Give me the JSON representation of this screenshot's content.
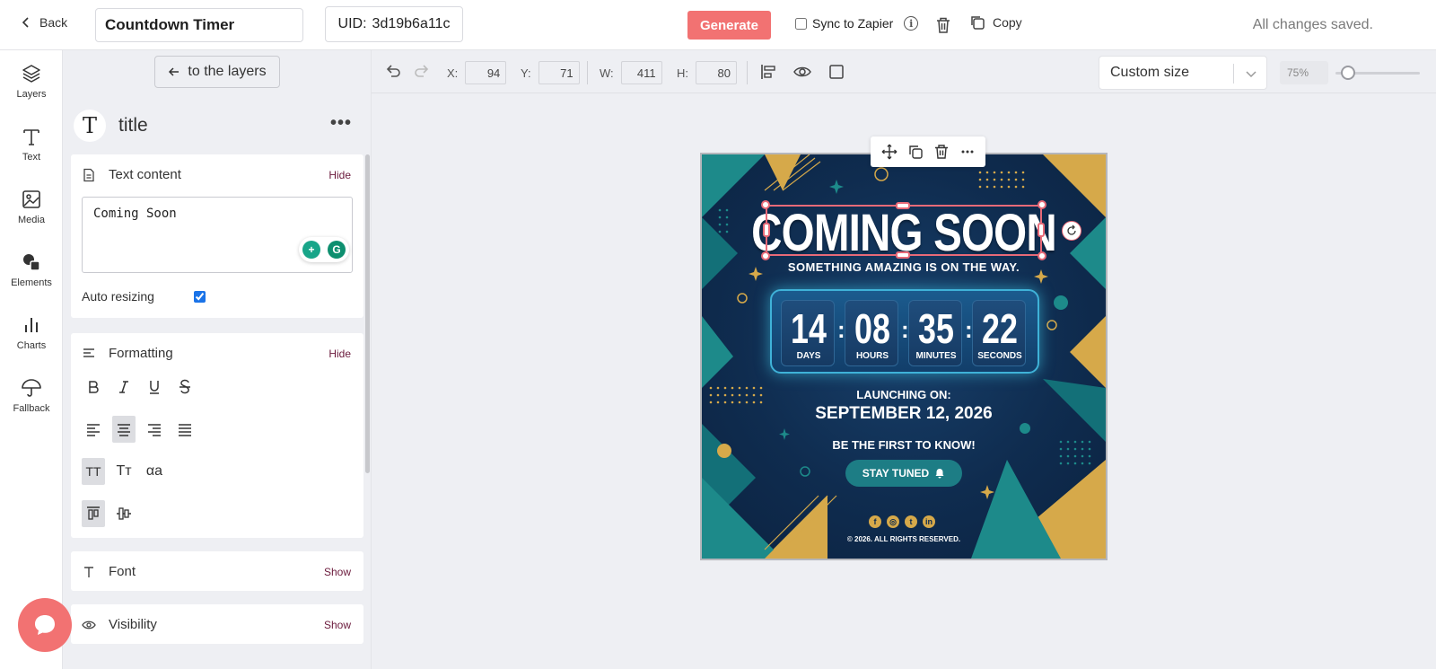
{
  "header": {
    "back_label": "Back",
    "project_name": "Countdown Timer",
    "uid_label": "UID:",
    "uid_value": "3d19b6a11c",
    "generate_label": "Generate",
    "sync_label": "Sync to Zapier",
    "copy_label": "Copy",
    "status": "All changes saved.",
    "accent_color": "#f27272"
  },
  "rail": {
    "items": [
      {
        "label": "Layers",
        "icon": "layers-icon"
      },
      {
        "label": "Text",
        "icon": "text-icon"
      },
      {
        "label": "Media",
        "icon": "image-icon"
      },
      {
        "label": "Elements",
        "icon": "shapes-icon"
      },
      {
        "label": "Charts",
        "icon": "chart-icon"
      },
      {
        "label": "Fallback",
        "icon": "umbrella-icon"
      }
    ]
  },
  "panel": {
    "layers_button": "to the layers",
    "layer_name": "title",
    "text_content": {
      "title": "Text content",
      "toggle": "Hide",
      "value": "Coming Soon",
      "auto_resizing_label": "Auto resizing",
      "auto_resizing": true
    },
    "formatting": {
      "title": "Formatting",
      "toggle": "Hide",
      "case_options": [
        "TT",
        "Tт",
        "αa"
      ]
    },
    "font": {
      "title": "Font",
      "toggle": "Show"
    },
    "visibility": {
      "title": "Visibility",
      "toggle": "Show"
    }
  },
  "toolbar": {
    "x_label": "X:",
    "x_value": "94",
    "y_label": "Y:",
    "y_value": "71",
    "w_label": "W:",
    "w_value": "411",
    "h_label": "H:",
    "h_value": "80",
    "size_select": "Custom size",
    "zoom": "75%",
    "zoom_fraction": 0.08
  },
  "poster": {
    "title": "COMING SOON",
    "subtitle": "SOMETHING AMAZING IS ON THE WAY.",
    "timer": [
      {
        "value": "14",
        "label": "DAYS"
      },
      {
        "value": "08",
        "label": "HOURS"
      },
      {
        "value": "35",
        "label": "MINUTES"
      },
      {
        "value": "22",
        "label": "SECONDS"
      }
    ],
    "launch_label": "LAUNCHING ON:",
    "launch_date": "SEPTEMBER 12, 2026",
    "cta_text": "BE THE FIRST TO KNOW!",
    "cta_button": "STAY TUNED",
    "social": [
      "f",
      "◎",
      "t",
      "in"
    ],
    "copyright": "© 2026. ALL RIGHTS RESERVED.",
    "colors": {
      "navy": "#0f2c4f",
      "teal": "#1d7d85",
      "gold": "#d6a94a"
    }
  }
}
